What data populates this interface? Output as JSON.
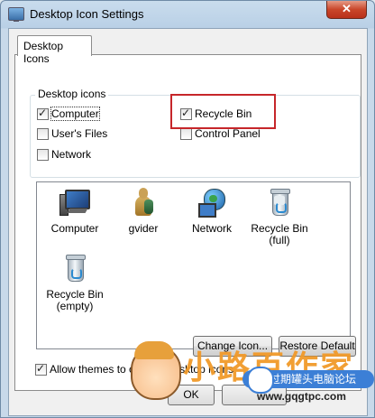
{
  "window": {
    "title": "Desktop Icon Settings",
    "close_glyph": "✕"
  },
  "tabs": [
    {
      "label": "Desktop Icons"
    }
  ],
  "desktop_icons_group": {
    "label": "Desktop icons",
    "checkboxes": [
      {
        "label": "Computer",
        "checked": true
      },
      {
        "label": "Recycle Bin",
        "checked": true
      },
      {
        "label": "User's Files",
        "checked": false
      },
      {
        "label": "Control Panel",
        "checked": false
      },
      {
        "label": "Network",
        "checked": false
      }
    ]
  },
  "icon_list": [
    {
      "label": "Computer",
      "icon": "computer-icon"
    },
    {
      "label": "gvider",
      "icon": "user-folder-icon"
    },
    {
      "label": "Network",
      "icon": "network-icon"
    },
    {
      "label": "Recycle Bin\n(full)",
      "icon": "recycle-bin-full-icon"
    },
    {
      "label": "Recycle Bin\n(empty)",
      "icon": "recycle-bin-empty-icon"
    }
  ],
  "buttons": {
    "change_icon": "Change Icon...",
    "restore_default": "Restore Default",
    "ok": "OK"
  },
  "allow_themes": {
    "label": "Allow themes to change desktop icons",
    "checked": true
  },
  "watermark": {
    "text": "小路百作家",
    "badge": "过期罐头电脑论坛",
    "url": "www.gqgtpc.com"
  },
  "colors": {
    "highlight": "#c6262a",
    "titlebar": "#b9d0e6"
  }
}
